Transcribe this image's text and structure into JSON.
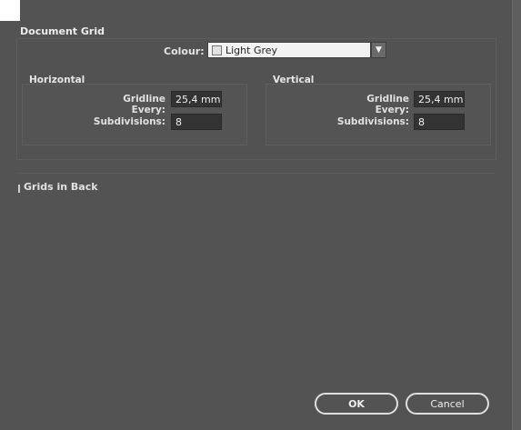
{
  "dialog": {
    "section_title": "Document Grid",
    "colour": {
      "label": "Colour:",
      "value": "Light Grey",
      "swatch_color": "#e2e2e2",
      "dropdown_icon": "chevron-down-icon"
    },
    "horizontal": {
      "title": "Horizontal",
      "gridline_label": "Gridline Every:",
      "gridline_value": "25,4 mm",
      "subdivisions_label": "Subdivisions:",
      "subdivisions_value": "8"
    },
    "vertical": {
      "title": "Vertical",
      "gridline_label": "Gridline Every:",
      "gridline_value": "25,4 mm",
      "subdivisions_label": "Subdivisions:",
      "subdivisions_value": "8"
    },
    "grids_in_back_label": "Grids in Back",
    "buttons": {
      "ok": "OK",
      "cancel": "Cancel"
    }
  }
}
